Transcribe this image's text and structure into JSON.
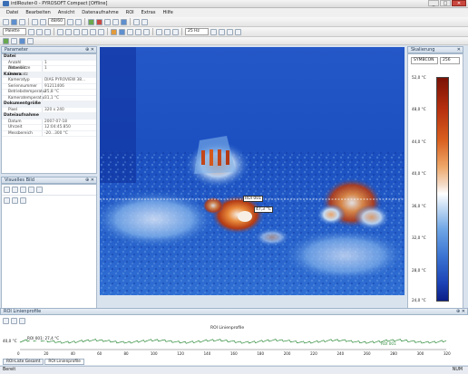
{
  "window": {
    "title": "irdIRouter-0 - PYROSOFT Compact [Offline]",
    "buttons": [
      "_",
      "□",
      "✕"
    ]
  },
  "menu": [
    "Datei",
    "Bearbeiten",
    "Ansicht",
    "Datenaufnahme",
    "ROI",
    "Extras",
    "Hilfe"
  ],
  "toolbar": {
    "page_select": "Datei",
    "zoom_value": "25 Hz",
    "frame_value": "48/60",
    "palette_select": "Palette"
  },
  "properties": {
    "title": "Parameter",
    "categories": [
      {
        "name": "Datei",
        "rows": [
          {
            "k": "Anzahl Datensätze",
            "v": "1"
          },
          {
            "k": "Aktueller Datensatz",
            "v": "1"
          }
        ]
      },
      {
        "name": "Kamera",
        "rows": [
          {
            "k": "Kameratyp",
            "v": "DIAS PYROVIEW 38..."
          },
          {
            "k": "Seriennummer",
            "v": "91211406"
          },
          {
            "k": "Betriebstemperatur",
            "v": "25,8 °C"
          },
          {
            "k": "Kameratemperatur",
            "v": "31,1 °C"
          }
        ]
      },
      {
        "name": "Dokumentgröße",
        "rows": [
          {
            "k": "Pixel",
            "v": "320 x 240"
          }
        ]
      },
      {
        "name": "Dateiaufnahme",
        "rows": [
          {
            "k": "Datum",
            "v": "2007-07-18"
          },
          {
            "k": "Uhrzeit",
            "v": "12:04:45.850"
          },
          {
            "k": "Messbereich",
            "v": "-20...300 °C"
          }
        ]
      }
    ]
  },
  "visual_panel": {
    "title": "Visuelles Bild"
  },
  "thermal": {
    "roi_label": "ROI 001",
    "roi_value": "47,3 °C"
  },
  "scale": {
    "title": "Skalierung",
    "palette": "SYMBCON",
    "levels": "256",
    "ticks": [
      "52,0 °C",
      "48,0 °C",
      "44,0 °C",
      "40,0 °C",
      "36,0 °C",
      "32,0 °C",
      "28,0 °C",
      "24,0 °C"
    ]
  },
  "profile": {
    "title": "ROI Linienprofile",
    "chart_title": "ROI Linienprofile",
    "series_label": "ROI 001: 27,4 °C",
    "end_label": "ROI 001",
    "y_label": "40,0 °C",
    "x_ticks": [
      "0",
      "20",
      "40",
      "60",
      "80",
      "100",
      "120",
      "140",
      "160",
      "180",
      "200",
      "220",
      "240",
      "260",
      "280",
      "300",
      "320"
    ]
  },
  "tabs": [
    "ROI-Liste Gesamt",
    "ROI Linienprofile"
  ],
  "status": {
    "left": "Bereit",
    "right": "NUM"
  },
  "colors": {
    "thermal_bg": "#1e5fc8",
    "hot": "#e36a1d",
    "cold": "#0c1e86",
    "profile_line": "#2e8b3a"
  }
}
